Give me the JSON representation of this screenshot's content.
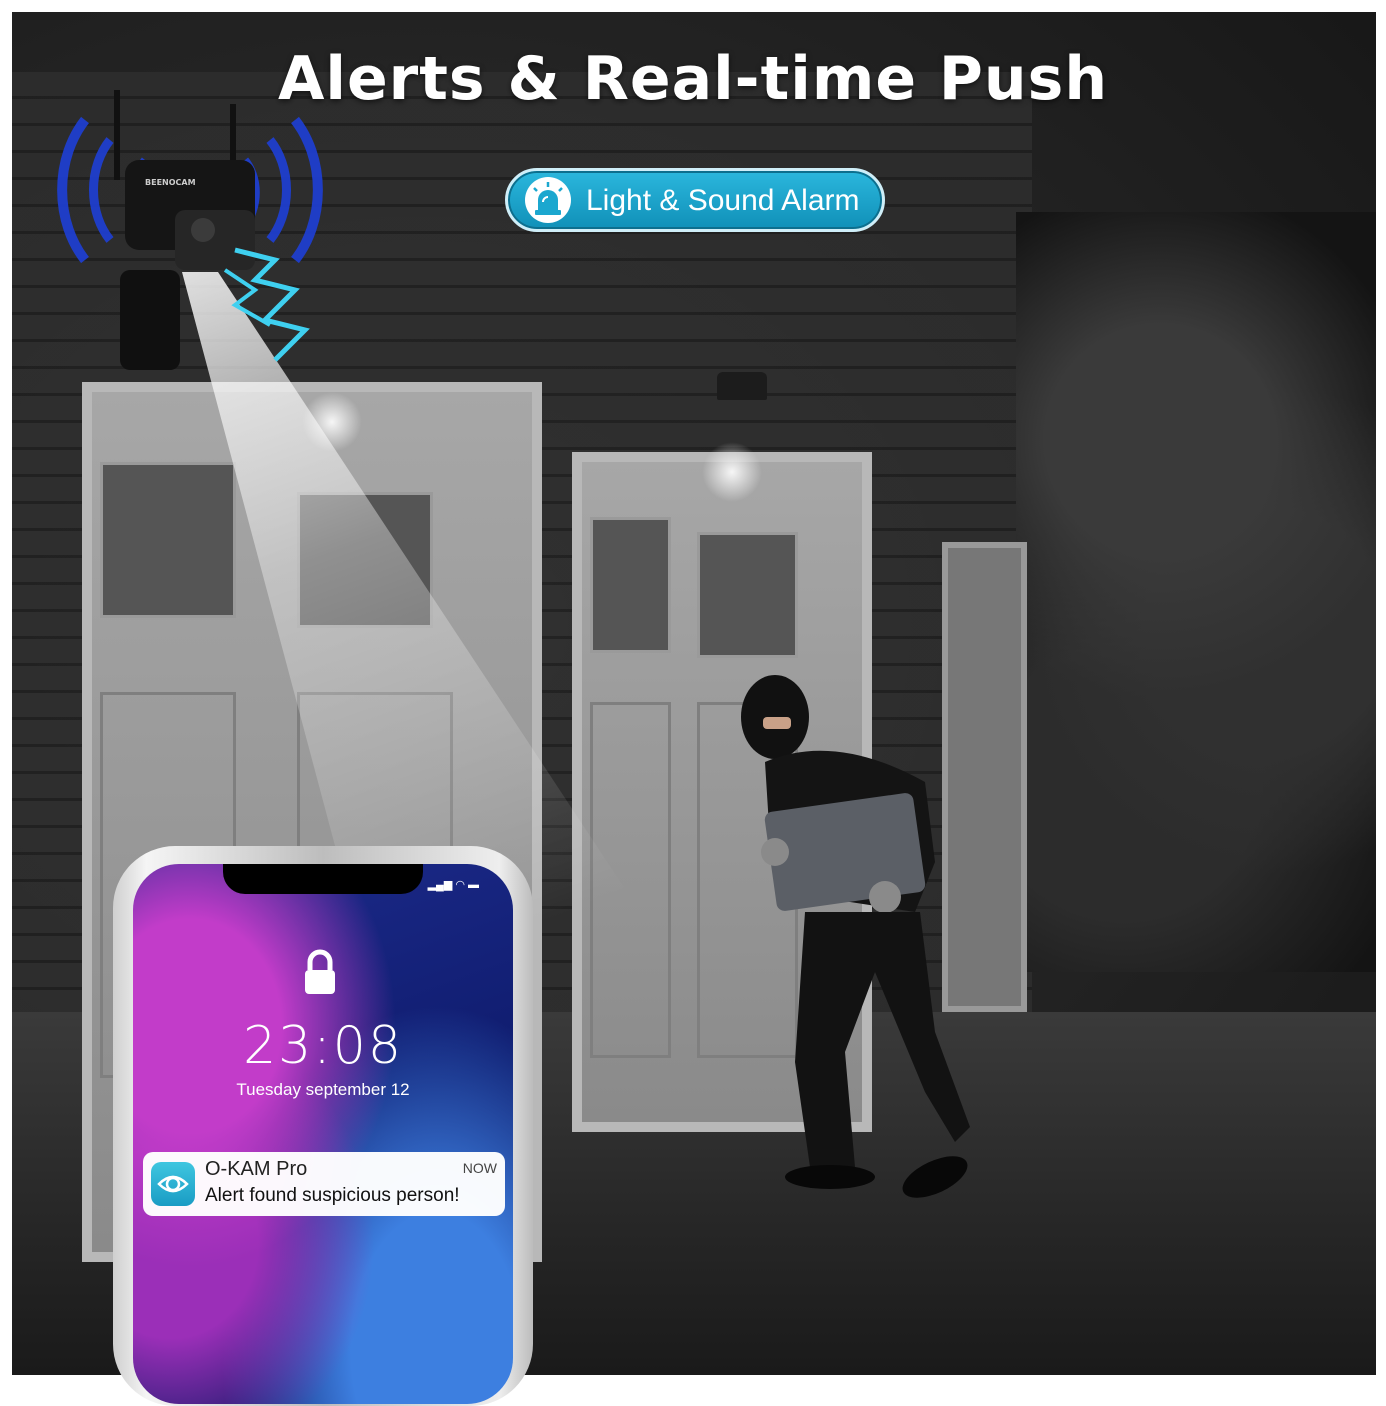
{
  "headline": "Alerts & Real-time Push",
  "badge": {
    "label": "Light & Sound Alarm",
    "icon": "siren-icon"
  },
  "camera": {
    "brand": "BEENOCAM"
  },
  "phone": {
    "time": "23:08",
    "date": "Tuesday september 12",
    "notification": {
      "app": "O-KAM Pro",
      "time": "NOW",
      "message": "Alert found suspicious person!",
      "icon": "eye-icon"
    }
  },
  "colors": {
    "accent": "#1ba7cf",
    "signal": "#1e3fd6"
  }
}
